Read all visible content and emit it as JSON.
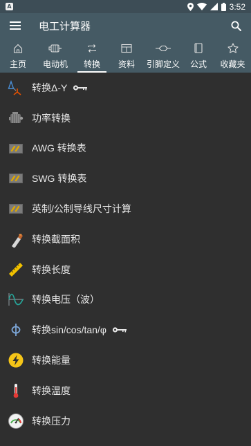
{
  "status": {
    "time": "3:52"
  },
  "appbar": {
    "title": "电工计算器"
  },
  "tabs": [
    {
      "label": "主页",
      "icon": "home-icon"
    },
    {
      "label": "电动机",
      "icon": "motor-icon"
    },
    {
      "label": "转换",
      "icon": "convert-icon",
      "active": true
    },
    {
      "label": "资料",
      "icon": "table-icon"
    },
    {
      "label": "引脚定义",
      "icon": "pinout-icon"
    },
    {
      "label": "公式",
      "icon": "book-icon"
    },
    {
      "label": "收藏夹",
      "icon": "star-icon"
    }
  ],
  "list": [
    {
      "label": "转换Δ-Y",
      "icon": "delta-wye-icon",
      "locked": true
    },
    {
      "label": "功率转换",
      "icon": "engine-icon"
    },
    {
      "label": "AWG 转换表",
      "icon": "wire-gauge-icon"
    },
    {
      "label": "SWG 转换表",
      "icon": "wire-gauge-icon"
    },
    {
      "label": "英制/公制导线尺寸计算",
      "icon": "wire-gauge-icon"
    },
    {
      "label": "转换截面积",
      "icon": "cable-section-icon"
    },
    {
      "label": "转换长度",
      "icon": "ruler-icon"
    },
    {
      "label": "转换电压（波）",
      "icon": "sine-wave-icon"
    },
    {
      "label": "转换sin/cos/tan/φ",
      "icon": "phi-icon",
      "locked": true
    },
    {
      "label": "转换能量",
      "icon": "lightning-icon"
    },
    {
      "label": "转换温度",
      "icon": "thermometer-icon"
    },
    {
      "label": "转换压力",
      "icon": "gauge-icon"
    }
  ],
  "colors": {
    "statusbar": "#3d4d56",
    "appbar": "#455a64",
    "background": "#2f2f2f",
    "accent": "#f5c518"
  }
}
